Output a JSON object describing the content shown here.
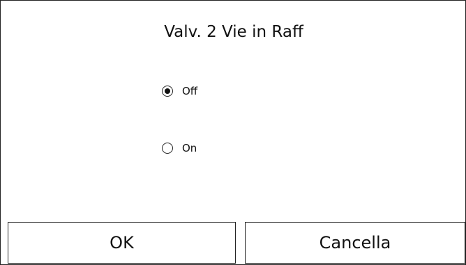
{
  "dialog": {
    "title": "Valv. 2 Vie in Raff",
    "options": [
      {
        "label": "Off",
        "selected": true
      },
      {
        "label": "On",
        "selected": false
      }
    ],
    "buttons": {
      "ok_label": "OK",
      "cancel_label": "Cancella"
    }
  }
}
